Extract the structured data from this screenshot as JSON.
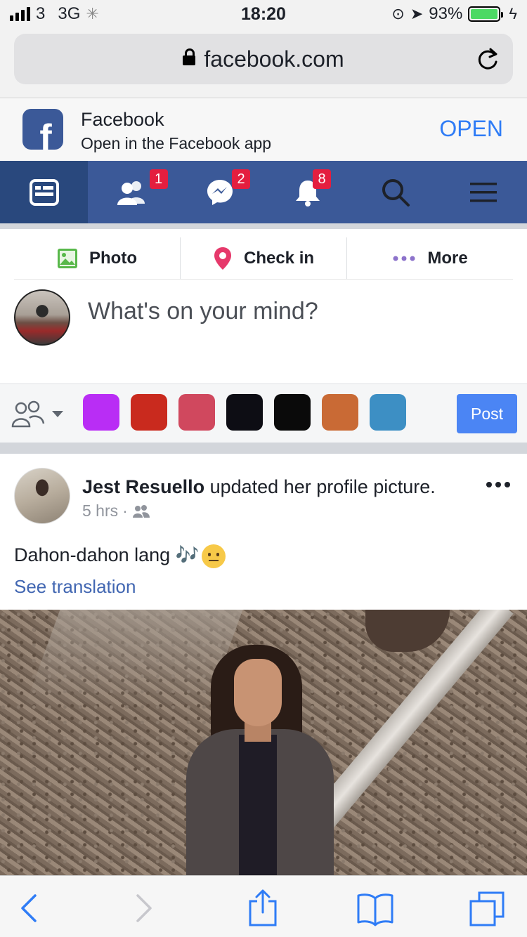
{
  "status_bar": {
    "carrier": "3",
    "network": "3G",
    "time": "18:20",
    "battery": "93%"
  },
  "address_bar": {
    "url": "facebook.com"
  },
  "app_banner": {
    "logo_letter": "f",
    "title": "Facebook",
    "subtitle": "Open in the Facebook app",
    "open_label": "OPEN"
  },
  "nav": {
    "friends_badge": "1",
    "messages_badge": "2",
    "notifications_badge": "8"
  },
  "composer": {
    "photo_label": "Photo",
    "checkin_label": "Check in",
    "more_label": "More",
    "placeholder": "What's on your mind?",
    "post_label": "Post",
    "backgrounds": [
      "#b92df5",
      "#c92a1e",
      "#d0485e",
      "#0d0d14",
      "#0a0a0a",
      "#c96a35",
      "#3d8fc4"
    ]
  },
  "post": {
    "author": "Jest Resuello",
    "action": " updated her profile picture.",
    "time": "5 hrs",
    "separator": "·",
    "text": "Dahon-dahon lang 🎶",
    "see_translation": "See translation"
  },
  "colors": {
    "facebook_blue": "#3b5998",
    "active_tab": "#29487d",
    "badge_red": "#e41e3f",
    "link_blue": "#4267b2",
    "post_button": "#4b85f4",
    "ios_blue": "#2f7cf6"
  }
}
